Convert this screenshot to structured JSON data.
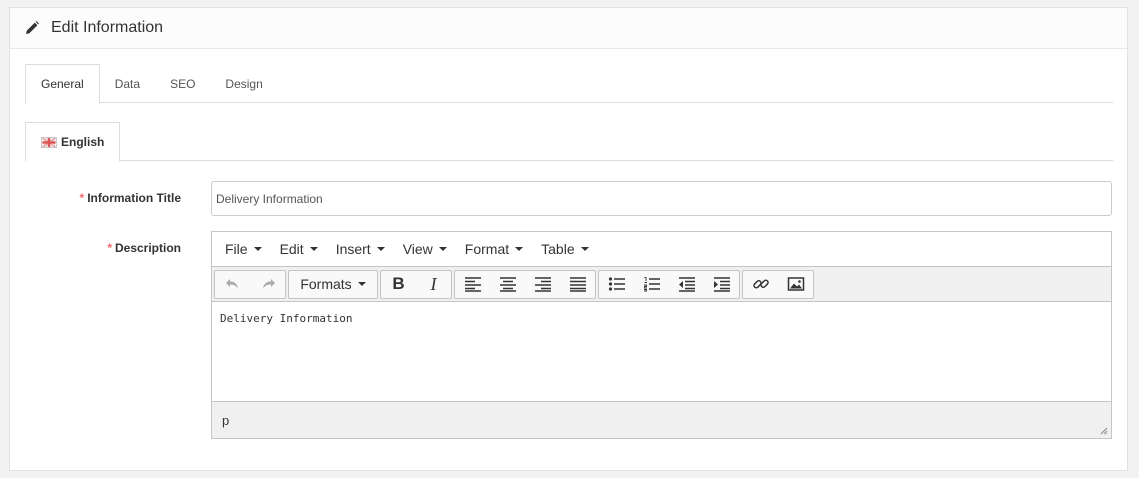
{
  "panel": {
    "title": "Edit Information",
    "icon": "pencil-icon"
  },
  "tabs": [
    {
      "label": "General",
      "active": true
    },
    {
      "label": "Data",
      "active": false
    },
    {
      "label": "SEO",
      "active": false
    },
    {
      "label": "Design",
      "active": false
    }
  ],
  "language_tab": {
    "label": "English",
    "icon": "uk-flag-icon"
  },
  "form": {
    "title_label": "Information Title",
    "title_value": "Delivery Information",
    "description_label": "Description",
    "required_mark": "*"
  },
  "editor": {
    "menus": [
      "File",
      "Edit",
      "Insert",
      "View",
      "Format",
      "Table"
    ],
    "formats_label": "Formats",
    "bold_label": "B",
    "italic_label": "I",
    "content": "Delivery Information",
    "status_path": "p"
  }
}
